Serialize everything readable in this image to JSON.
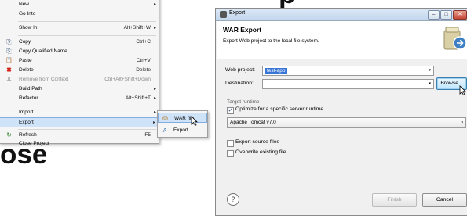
{
  "context_menu": {
    "items": [
      {
        "label": "New",
        "shortcut": "",
        "arrow": "▸",
        "icon": ""
      },
      {
        "label": "Go Into",
        "shortcut": "",
        "arrow": "",
        "icon": ""
      },
      {
        "label": "Show In",
        "shortcut": "Alt+Shift+W",
        "arrow": "▸",
        "icon": ""
      },
      {
        "label": "Copy",
        "shortcut": "Ctrl+C",
        "arrow": "",
        "icon": "⎘"
      },
      {
        "label": "Copy Qualified Name",
        "shortcut": "",
        "arrow": "",
        "icon": "⎘"
      },
      {
        "label": "Paste",
        "shortcut": "Ctrl+V",
        "arrow": "",
        "icon": "📋"
      },
      {
        "label": "Delete",
        "shortcut": "Delete",
        "arrow": "",
        "icon": "✖"
      },
      {
        "label": "Remove from Context",
        "shortcut": "Ctrl+Alt+Shift+Down",
        "arrow": "",
        "icon": "⇊"
      },
      {
        "label": "Build Path",
        "shortcut": "",
        "arrow": "▸",
        "icon": ""
      },
      {
        "label": "Refactor",
        "shortcut": "Alt+Shift+T",
        "arrow": "▸",
        "icon": ""
      },
      {
        "label": "Import",
        "shortcut": "",
        "arrow": "▸",
        "icon": ""
      },
      {
        "label": "Export",
        "shortcut": "",
        "arrow": "▸",
        "icon": ""
      },
      {
        "label": "Refresh",
        "shortcut": "F5",
        "arrow": "",
        "icon": "↻"
      },
      {
        "label": "Close Project",
        "shortcut": "",
        "arrow": "",
        "icon": ""
      }
    ]
  },
  "export_submenu": {
    "items": [
      {
        "label": "WAR file",
        "icon": "⛁"
      },
      {
        "label": "Export...",
        "icon": "⇗"
      }
    ]
  },
  "overlay_text": {
    "left": "ose",
    "top": "p"
  },
  "dialog": {
    "title": "Export",
    "header_title": "WAR Export",
    "header_desc": "Export Web project to the local file system.",
    "web_project_label": "Web project:",
    "web_project_value": "test-app",
    "destination_label": "Destination:",
    "destination_value": "",
    "browse_label": "Browse...",
    "target_runtime_label": "Target runtime",
    "optimize_label": "Optimize for a specific server runtime",
    "optimize_checked": true,
    "runtime_value": "Apache Tomcat v7.0",
    "export_source_label": "Export source files",
    "overwrite_label": "Overwrite existing file",
    "help_label": "?",
    "finish_label": "Finish",
    "cancel_label": "Cancel",
    "minimize_glyph": "–",
    "maximize_glyph": "□",
    "close_glyph": "✕",
    "dropdown_glyph": "▾",
    "check_glyph": "✓"
  },
  "colors": {
    "menu_highlight": "#cfe3f8",
    "delete_icon": "#d2271c",
    "selection": "#3875d7"
  }
}
